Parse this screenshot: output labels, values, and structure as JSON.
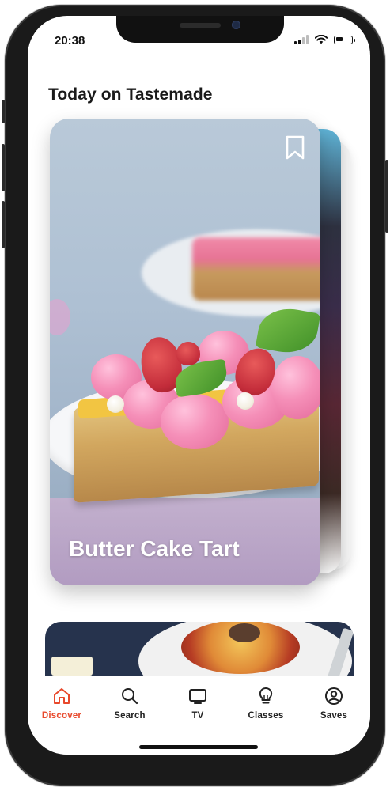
{
  "status_bar": {
    "time": "20:38"
  },
  "section": {
    "title": "Today on Tastemade"
  },
  "featured_card": {
    "title": "Butter Cake Tart"
  },
  "tabs": [
    {
      "label": "Discover",
      "icon": "home-icon",
      "active": true
    },
    {
      "label": "Search",
      "icon": "search-icon",
      "active": false
    },
    {
      "label": "TV",
      "icon": "tv-icon",
      "active": false
    },
    {
      "label": "Classes",
      "icon": "lightbulb-icon",
      "active": false
    },
    {
      "label": "Saves",
      "icon": "profile-icon",
      "active": false
    }
  ],
  "colors": {
    "accent": "#e8492c",
    "text": "#1a1a1a"
  }
}
